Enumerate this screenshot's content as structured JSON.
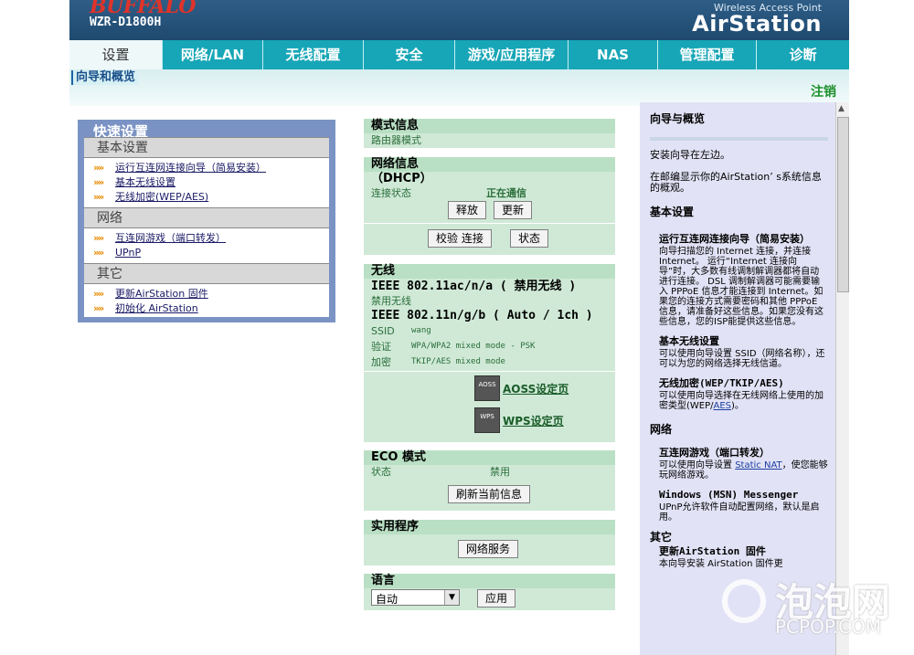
{
  "header": {
    "logo": "BUFFALO",
    "model": "WZR-D1800H",
    "brand_sub": "Wireless Access Point",
    "brand_main": "AirStation"
  },
  "nav": {
    "tabs": [
      "设置",
      "网络/LAN",
      "无线配置",
      "安全",
      "游戏/应用程序",
      "NAS",
      "管理配置",
      "诊断"
    ]
  },
  "subnav": {
    "tab": "向导和概览",
    "logout": "注销"
  },
  "quick": {
    "title": "快速设置",
    "sections": [
      {
        "label": "基本设置",
        "items": [
          "运行互连网连接向导（简易安装）",
          "基本无线设置",
          "无线加密(WEP/AES)"
        ]
      },
      {
        "label": "网络",
        "items": [
          "互连网游戏（端口转发）",
          "UPnP"
        ]
      },
      {
        "label": "其它",
        "items": [
          "更新AirStation 固件",
          "初始化 AirStation"
        ]
      }
    ]
  },
  "mode": {
    "title": "模式信息",
    "value": "路由器模式"
  },
  "network": {
    "title": "网络信息",
    "subtitle": "（DHCP）",
    "status_label": "连接状态",
    "status_value": "正在通信",
    "release": "释放",
    "renew": "更新",
    "verify": "校验 连接",
    "state": "状态"
  },
  "wireless": {
    "title": "无线",
    "band_a": "IEEE 802.11ac/n/a ( 禁用无线 )",
    "disabled": "禁用无线",
    "band_g": "IEEE 802.11n/g/b ( Auto / 1ch )",
    "ssid_label": "SSID",
    "ssid_value": "wang",
    "auth_label": "验证",
    "auth_value": "WPA/WPA2 mixed mode - PSK",
    "enc_label": "加密",
    "enc_value": "TKIP/AES mixed mode",
    "aoss_icon_text": "AOSS",
    "aoss": "AOSS设定页",
    "wps_icon_text": "WPS",
    "wps": "WPS设定页"
  },
  "eco": {
    "title": "ECO 模式",
    "status_label": "状态",
    "status_value": "禁用",
    "refresh": "刷新当前信息"
  },
  "utility": {
    "title": "实用程序",
    "service": "网络服务"
  },
  "language": {
    "title": "语言",
    "selected": "自动",
    "apply": "应用"
  },
  "help": {
    "title": "向导与概览",
    "p1": "安装向导在左边。",
    "p2": "在邮编显示你的AirStation’ s系统信息的概观。",
    "sec_basic": "基本设置",
    "sub_wizard": "运行互连网连接向导（简易安装）",
    "p_wizard": "向导扫描您的 Internet 连接，并连接 Internet。 运行“Internet 连接向导”时，大多数有线调制解调器都将自动进行连接。 DSL 调制解调器可能需要输入 PPPoE 信息才能连接到 Internet。如果您的连接方式需要密码和其他 PPPoE 信息，请准备好这些信息。如果您没有这些信息，您的ISP能提供这些信息。",
    "sub_wireless": "基本无线设置",
    "p_wireless": "可以使用向导设置 SSID（网络名称），还可以为您的网络选择无线信道。",
    "sub_enc": "无线加密(WEP/TKIP/AES)",
    "p_enc_pre": "可以使用向导选择在无线网络上使用的加密类型(WEP/",
    "p_enc_link": "AES",
    "p_enc_post": ")。",
    "sec_net": "网络",
    "sub_game": "互连网游戏（端口转发）",
    "p_game_pre": "可以使用向导设置 ",
    "p_game_link": "Static NAT",
    "p_game_post": "，使您能够玩网络游戏。",
    "sub_msn": "Windows (MSN) Messenger",
    "p_msn": "UPnP允许软件自动配置网络，默认是启用。",
    "sec_other": "其它",
    "sub_fw": "更新AirStation 固件",
    "p_fw": "本向导安装 AirStation 固件更"
  },
  "watermark": {
    "cn": "泡泡网",
    "en": "PCPOP.COM"
  }
}
